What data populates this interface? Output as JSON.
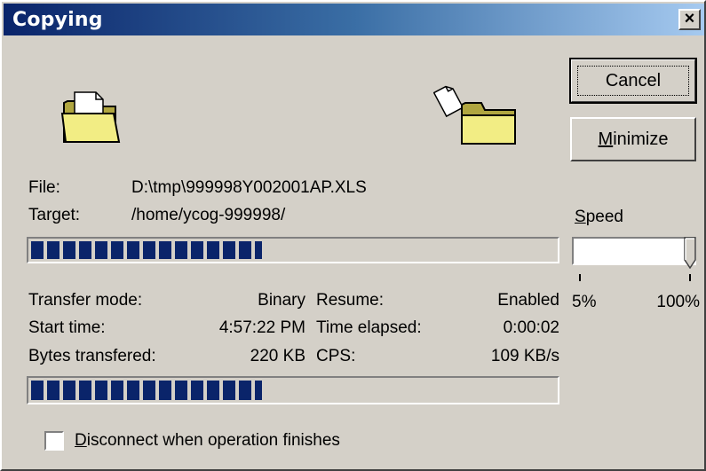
{
  "window": {
    "title": "Copying",
    "close_label": "×"
  },
  "buttons": {
    "cancel": "Cancel",
    "minimize_first": "M",
    "minimize_rest": "inimize"
  },
  "file": {
    "label": "File:",
    "value": "D:\\tmp\\999998Y002001AP.XLS"
  },
  "target": {
    "label": "Target:",
    "value": "/home/ycog-999998/"
  },
  "progress": {
    "file_fraction": 0.44,
    "total_fraction": 0.44
  },
  "stats": {
    "transfer_mode": {
      "label": "Transfer mode:",
      "value": "Binary"
    },
    "start_time": {
      "label": "Start time:",
      "value": "4:57:22 PM"
    },
    "bytes_transfered": {
      "label": "Bytes transfered:",
      "value": "220 KB"
    },
    "resume": {
      "label": "Resume:",
      "value": "Enabled"
    },
    "time_elapsed": {
      "label": "Time elapsed:",
      "value": "0:00:02"
    },
    "cps": {
      "label": "CPS:",
      "value": "109 KB/s"
    }
  },
  "speed": {
    "label_first": "S",
    "label_rest": "peed",
    "min_label": "5%",
    "max_label": "100%",
    "level_fraction": 1.0
  },
  "disconnect": {
    "label_first": "D",
    "label_rest": "isconnect when operation finishes",
    "checked": false
  },
  "icons": {
    "source": "open-folder-icon",
    "target": "folder-icon",
    "document": "document-icon"
  },
  "colors": {
    "progress": "#0a246a",
    "title_start": "#0a246a",
    "title_end": "#a6caf0",
    "face": "#d4d0c8"
  }
}
